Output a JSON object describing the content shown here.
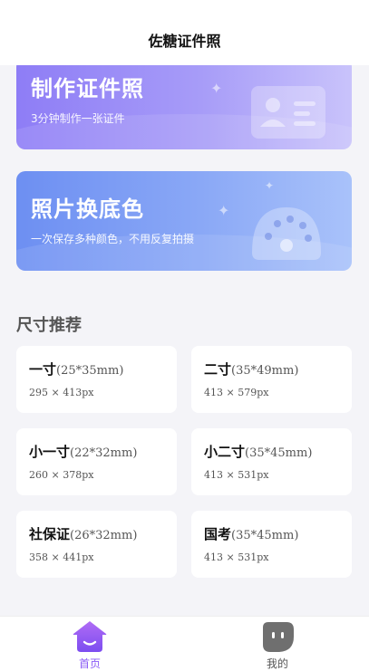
{
  "header": {
    "title": "佐糖证件照"
  },
  "banners": [
    {
      "title": "制作证件照",
      "subtitle": "3分钟制作一张证件",
      "icon": "id-card-icon"
    },
    {
      "title": "照片换底色",
      "subtitle": "一次保存多种颜色，不用反复拍摄",
      "icon": "palette-icon"
    }
  ],
  "section": {
    "title": "尺寸推荐"
  },
  "sizes": [
    {
      "name": "一寸",
      "spec": "(25*35mm)",
      "px": "295 × 413px"
    },
    {
      "name": "二寸",
      "spec": "(35*49mm)",
      "px": "413 × 579px"
    },
    {
      "name": "小一寸",
      "spec": "(22*32mm)",
      "px": "260 × 378px"
    },
    {
      "name": "小二寸",
      "spec": "(35*45mm)",
      "px": "413 × 531px"
    },
    {
      "name": "社保证",
      "spec": "(26*32mm)",
      "px": "358 × 441px"
    },
    {
      "name": "国考",
      "spec": "(35*45mm)",
      "px": "413 × 531px"
    }
  ],
  "tabbar": {
    "items": [
      {
        "label": "首页",
        "icon": "home-icon",
        "active": true
      },
      {
        "label": "我的",
        "icon": "profile-icon",
        "active": false
      }
    ]
  },
  "colors": {
    "accent": "#8b5cf6",
    "banner_id": "#8e7df6",
    "banner_bg": "#6d8ff2",
    "page_bg": "#f4f4f8",
    "tab_inactive": "#555555"
  }
}
